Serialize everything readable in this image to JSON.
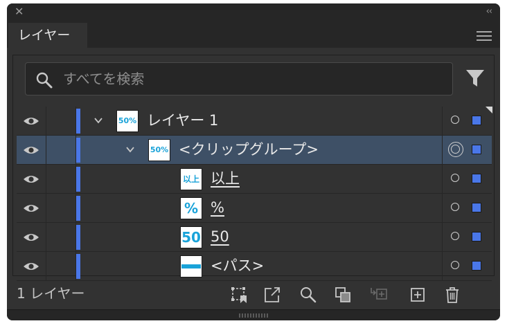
{
  "window": {
    "close_icon": "close-icon",
    "collapse_glyph": "‹‹"
  },
  "tab": {
    "label": "レイヤー"
  },
  "search": {
    "placeholder": "すべてを検索"
  },
  "layers": [
    {
      "name": "レイヤー 1",
      "thumb": "50%以上",
      "depth": 0,
      "expanded": true,
      "selected": false,
      "underline": false,
      "target": "single"
    },
    {
      "name": "<クリップグループ>",
      "thumb": "50%以上",
      "depth": 1,
      "expanded": true,
      "selected": true,
      "underline": false,
      "target": "double"
    },
    {
      "name": "以上",
      "thumb": "以上",
      "depth": 2,
      "expanded": false,
      "selected": false,
      "underline": true,
      "target": "single"
    },
    {
      "name": "%",
      "thumb": "%",
      "depth": 2,
      "expanded": false,
      "selected": false,
      "underline": true,
      "target": "single"
    },
    {
      "name": "50",
      "thumb": "50",
      "depth": 2,
      "expanded": false,
      "selected": false,
      "underline": true,
      "target": "single"
    },
    {
      "name": "<パス>",
      "thumb": "stripe",
      "depth": 2,
      "expanded": false,
      "selected": false,
      "underline": false,
      "target": "single"
    }
  ],
  "footer": {
    "layer_count": "1 レイヤー",
    "buttons": [
      "export-for-screens-icon",
      "collect-for-export-icon",
      "locate-object-icon",
      "make-clipping-mask-icon",
      "create-sublayer-icon",
      "new-layer-icon",
      "delete-icon"
    ]
  },
  "colors": {
    "panel_bg": "#323232",
    "header_bg": "#262626",
    "selected_row": "#3e5066",
    "layer_color": "#4a77e8",
    "thumb_text": "#1aa3d9"
  }
}
